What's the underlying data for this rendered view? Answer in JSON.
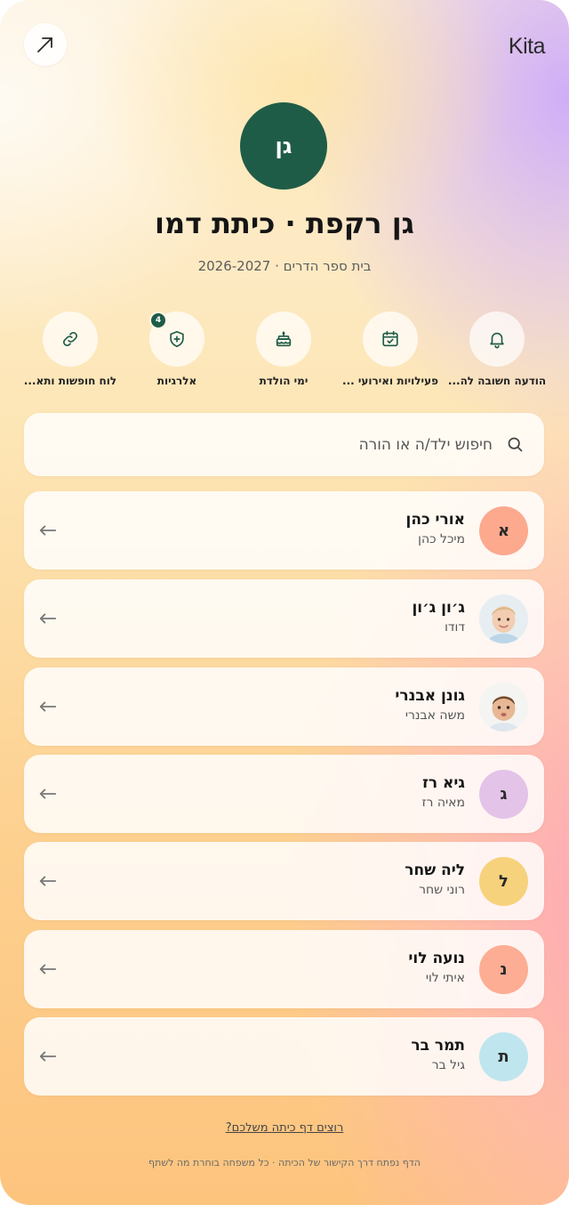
{
  "app": {
    "logo": "Kita"
  },
  "class": {
    "initials": "גן",
    "title": "גן רקפת · כיתת דמו",
    "subtitle": "בית ספר הדרים · 2026-2027"
  },
  "quick_actions": [
    {
      "label": "הודעה חשובה לה...",
      "icon": "bell-icon"
    },
    {
      "label": "פעילויות ואירועי ...",
      "icon": "calendar-check-icon"
    },
    {
      "label": "ימי הולדת",
      "icon": "birthday-cake-icon"
    },
    {
      "label": "אלרגיות",
      "icon": "shield-plus-icon",
      "badge": "4"
    },
    {
      "label": "לוח חופשות ותא...",
      "icon": "link-icon"
    }
  ],
  "search": {
    "placeholder": "חיפוש ילד/ה או הורה"
  },
  "children": [
    {
      "name": "אורי כהן",
      "parent": "מיכל כהן",
      "initial": "א",
      "avatar_color": "#fca98e",
      "avatar": "initial"
    },
    {
      "name": "ג׳ון ג׳ון",
      "parent": "דודו",
      "initial": "",
      "avatar": "photo-toddler"
    },
    {
      "name": "גונן אבנרי",
      "parent": "משה אבנרי",
      "initial": "",
      "avatar": "photo-baby"
    },
    {
      "name": "גיא רז",
      "parent": "מאיה רז",
      "initial": "ג",
      "avatar_color": "#e3c3e8",
      "avatar": "initial"
    },
    {
      "name": "ליה שחר",
      "parent": "רוני שחר",
      "initial": "ל",
      "avatar_color": "#f7d27c",
      "avatar": "initial"
    },
    {
      "name": "נועה לוי",
      "parent": "איתי לוי",
      "initial": "נ",
      "avatar_color": "#fcad93",
      "avatar": "initial"
    },
    {
      "name": "תמר בר",
      "parent": "גיל בר",
      "initial": "ת",
      "avatar_color": "#bfe6ee",
      "avatar": "initial"
    }
  ],
  "footer": {
    "link": "רוצים דף כיתה משלכם?",
    "note": "הדף נפתח דרך הקישור של הכיתה · כל משפחה בוחרת מה לשתף"
  },
  "colors": {
    "brand": "#1f5c47"
  }
}
